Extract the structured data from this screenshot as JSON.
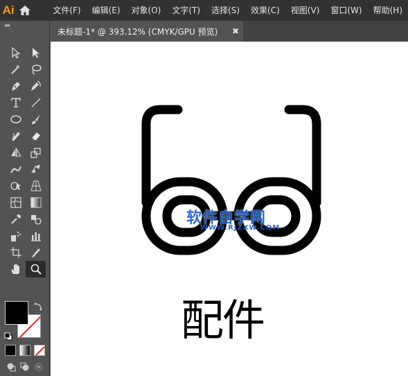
{
  "app": {
    "logo_text": "Ai",
    "menu": [
      "文件(F)",
      "编辑(E)",
      "对象(O)",
      "文字(T)",
      "选择(S)",
      "效果(C)",
      "视图(V)",
      "窗口(W)",
      "帮助(H)"
    ]
  },
  "toolbar": {
    "collapse_label": "◂◂",
    "tools": [
      "selection-tool-icon",
      "direct-selection-tool-icon",
      "magic-wand-tool-icon",
      "lasso-tool-icon",
      "pen-tool-icon",
      "curvature-tool-icon",
      "type-tool-icon",
      "line-segment-tool-icon",
      "ellipse-tool-icon",
      "paintbrush-tool-icon",
      "shaper-tool-icon",
      "eraser-tool-icon",
      "reflect-tool-icon",
      "scale-tool-icon",
      "puppet-warp-tool-icon",
      "free-transform-tool-icon",
      "shape-builder-tool-icon",
      "perspective-grid-tool-icon",
      "mesh-tool-icon",
      "gradient-tool-icon",
      "eyedropper-tool-icon",
      "blend-tool-icon",
      "symbol-sprayer-tool-icon",
      "column-graph-tool-icon",
      "artboard-tool-icon",
      "slice-tool-icon",
      "hand-tool-icon",
      "zoom-tool-icon"
    ],
    "active_tool": "zoom-tool-icon",
    "fill_color": "#000000",
    "stroke_color": "none"
  },
  "document": {
    "tab_title": "未标题-1* @ 393.12% (CMYK/GPU 预览)",
    "close_glyph": "✖"
  },
  "canvas": {
    "watermark_cn": "软件自学网",
    "watermark_en": "WWW.RJZXW.COM",
    "caption": "配件"
  },
  "colors": {
    "menubar": "#323232",
    "panel": "#535353",
    "accent_logo": "#ff9a00",
    "watermark": "#1d5fd3",
    "artwork": "#000000"
  }
}
